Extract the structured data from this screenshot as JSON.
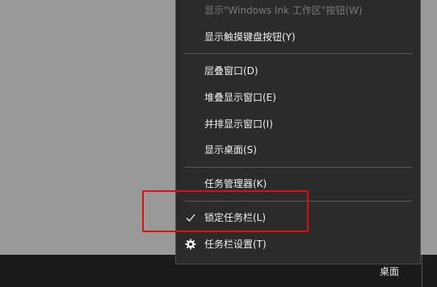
{
  "context_menu": {
    "items": {
      "show_ink_button": "显示\"Windows Ink 工作区\"按钮(W)",
      "show_touch_keyboard_button": "显示触摸键盘按钮(Y)",
      "cascade_windows": "层叠窗口(D)",
      "stack_windows": "堆叠显示窗口(E)",
      "side_by_side_windows": "并排显示窗口(I)",
      "show_desktop": "显示桌面(S)",
      "task_manager": "任务管理器(K)",
      "lock_taskbar": "锁定任务栏(L)",
      "taskbar_settings": "任务栏设置(T)"
    },
    "lock_taskbar_checked": true,
    "show_ink_button_disabled": true
  },
  "taskbar": {
    "desktop_label": "桌面"
  },
  "colors": {
    "menu_bg": "#2b2b2b",
    "menu_text": "#f0f0f0",
    "highlight": "#e01010",
    "desktop_bg": "#999999",
    "taskbar_bg": "#1b1b1b"
  },
  "icons": {
    "lock_taskbar": "checkmark-icon",
    "taskbar_settings": "gear-icon"
  }
}
